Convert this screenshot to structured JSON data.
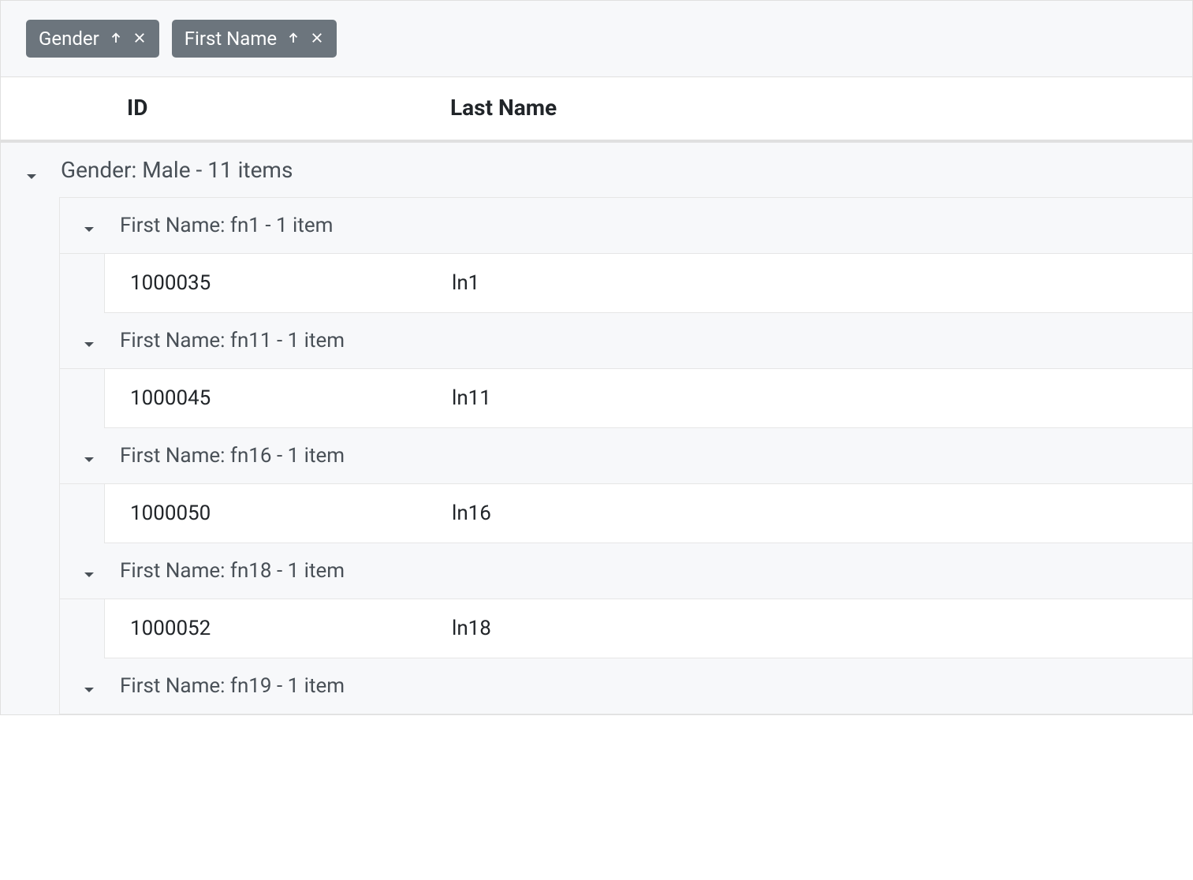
{
  "group_chips": [
    {
      "label": "Gender"
    },
    {
      "label": "First Name"
    }
  ],
  "columns": {
    "id": "ID",
    "last_name": "Last Name"
  },
  "group_l1": {
    "label": "Gender: Male - 11 items",
    "children": [
      {
        "label": "First Name: fn1 - 1 item",
        "rows": [
          {
            "id": "1000035",
            "last_name": "ln1"
          }
        ]
      },
      {
        "label": "First Name: fn11 - 1 item",
        "rows": [
          {
            "id": "1000045",
            "last_name": "ln11"
          }
        ]
      },
      {
        "label": "First Name: fn16 - 1 item",
        "rows": [
          {
            "id": "1000050",
            "last_name": "ln16"
          }
        ]
      },
      {
        "label": "First Name: fn18 - 1 item",
        "rows": [
          {
            "id": "1000052",
            "last_name": "ln18"
          }
        ]
      },
      {
        "label": "First Name: fn19 - 1 item",
        "rows": []
      }
    ]
  }
}
